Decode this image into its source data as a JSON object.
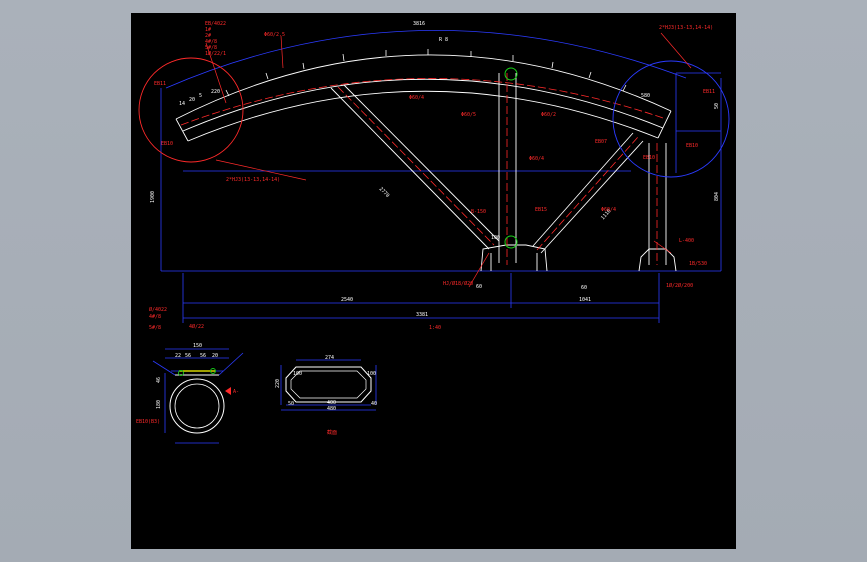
{
  "colors": {
    "background": "#aab1ba",
    "sheet": "#000000",
    "structure": "#ffffff",
    "dimension": "#2b3bff",
    "annotation": "#ff2a2a",
    "weld": "#ffff00",
    "marker": "#18d018"
  },
  "callouts": {
    "left_detail_top": "EB11",
    "left_detail_bottom": "EB10",
    "right_detail_top": "EB11",
    "right_detail_bottom": "EB10",
    "left_weld_note": "2*HJ3(13-13,14-14)",
    "right_weld_note": "2*HJ3(13-13,14-14)"
  },
  "dimensions": {
    "arc_length": "3816",
    "total_height": "1900",
    "right_height": "804",
    "right_rise": "50",
    "bottom_left": "2540",
    "bottom_right": "1041",
    "bottom_total": "3381",
    "left_diagonal": "2770",
    "right_diagonal": "1110",
    "left_offsets": [
      "14",
      "20",
      "5",
      "220"
    ],
    "right_offset": "580",
    "center_post_width": "100",
    "left_foot_angle": "60",
    "right_foot_angle": "60",
    "arc_r": "R 8"
  },
  "labels": {
    "top_left_notes": [
      "EB/4022",
      "1#",
      "2#",
      "4#/8",
      "5#/8",
      "1Ø/22/1"
    ],
    "mid_left_notes": [
      "Φ60/2.5",
      "Φ60/4"
    ],
    "center_notes": [
      "Φ60/5",
      "Φ60/2",
      "Φ60/4",
      "EB15"
    ],
    "foot_notes": [
      "HJ/Ø18/Ø20",
      "B-150",
      "1Ø/2Ø/200",
      "1B/530",
      "L-400"
    ],
    "right_notes": [
      "EB07",
      "Φ60/4",
      "EB10"
    ],
    "drawing_scale": "1:40"
  },
  "section_pipe": {
    "notes": [
      "Ø/4022",
      "4#/8",
      "5#/8",
      "4Ø/22"
    ],
    "top_width": "150",
    "segments": [
      "22",
      "56",
      "56",
      "20"
    ],
    "heights": [
      "46",
      "180"
    ],
    "bottom_note": "EB10(B3)",
    "arrow_label": "A-"
  },
  "section_box": {
    "top_width": "274",
    "left_height": "220",
    "left_small": "100",
    "right_small": "100",
    "right_lower": "40",
    "left_lower": "50",
    "bottom_width": "400",
    "outer_width": "480",
    "caption": "截面"
  }
}
